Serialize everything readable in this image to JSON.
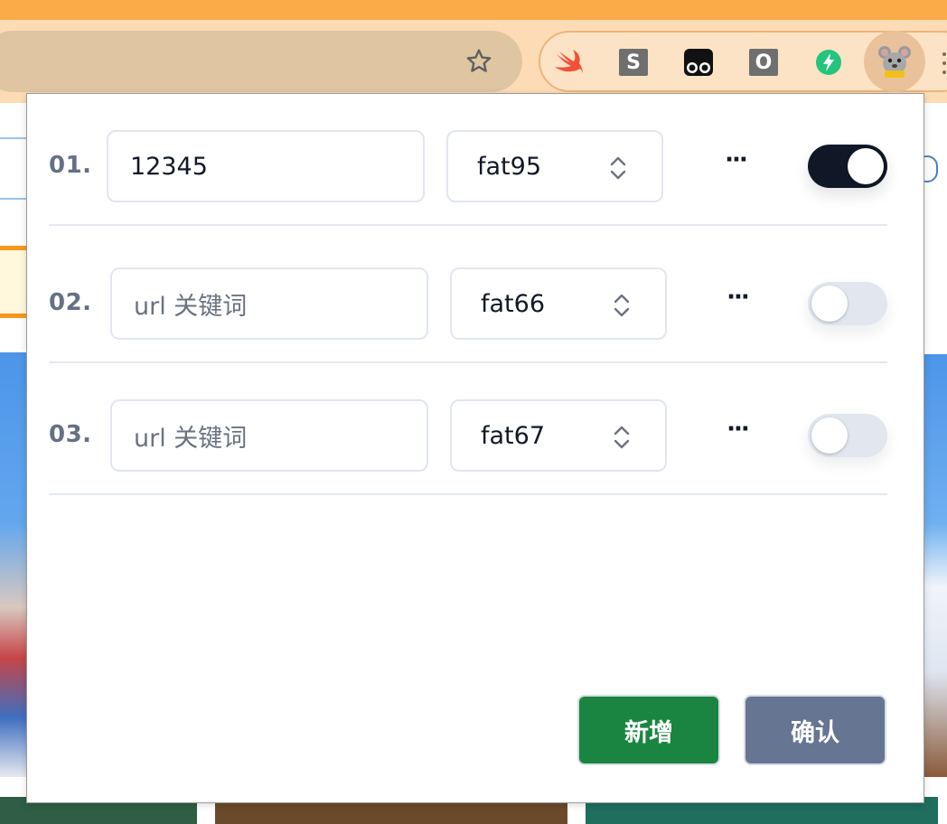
{
  "browser": {
    "extensions": [
      {
        "name": "swift-icon"
      },
      {
        "name": "s-extension-icon",
        "glyph": "S"
      },
      {
        "name": "tampermonkey-icon"
      },
      {
        "name": "o-extension-icon",
        "glyph": "O"
      },
      {
        "name": "lightning-extension-icon"
      },
      {
        "name": "mouse-extension-icon"
      }
    ]
  },
  "popup": {
    "rows": [
      {
        "num": "01.",
        "url_value": "12345",
        "url_placeholder": "url 关键词",
        "env": "fat95",
        "more": "···",
        "enabled": true
      },
      {
        "num": "02.",
        "url_value": "",
        "url_placeholder": "url 关键词",
        "env": "fat66",
        "more": "···",
        "enabled": false
      },
      {
        "num": "03.",
        "url_value": "",
        "url_placeholder": "url 关键词",
        "env": "fat67",
        "more": "···",
        "enabled": false
      }
    ],
    "add_label": "新增",
    "confirm_label": "确认"
  },
  "colors": {
    "accent_green": "#1a8540",
    "confirm_slate": "#667592",
    "toggle_on": "#101827",
    "toggle_off": "#e1e6ef"
  }
}
